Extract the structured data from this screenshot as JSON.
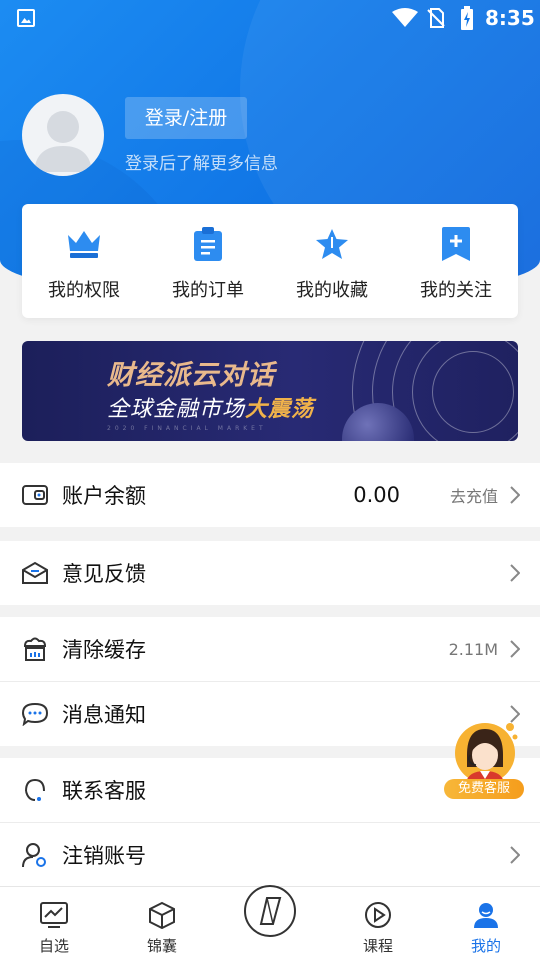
{
  "status_bar": {
    "time": "8:35"
  },
  "profile": {
    "login_button": "登录/注册",
    "hint": "登录后了解更多信息"
  },
  "quick_actions": [
    {
      "label": "我的权限",
      "icon": "crown-icon"
    },
    {
      "label": "我的订单",
      "icon": "clipboard-icon"
    },
    {
      "label": "我的收藏",
      "icon": "star-icon"
    },
    {
      "label": "我的关注",
      "icon": "bookmark-plus-icon"
    }
  ],
  "banner": {
    "title": "财经派云对话",
    "subtitle_part1": "全球金融市场",
    "subtitle_highlight": "大震荡",
    "small_text": "2020 FINANCIAL MARKET"
  },
  "menu": {
    "balance": {
      "label": "账户余额",
      "value": "0.00",
      "action": "去充值"
    },
    "feedback": {
      "label": "意见反馈"
    },
    "clear_cache": {
      "label": "清除缓存",
      "size": "2.11M"
    },
    "notifications": {
      "label": "消息通知"
    },
    "customer_service": {
      "label": "联系客服"
    },
    "delete_account": {
      "label": "注销账号"
    }
  },
  "floating_service": {
    "label": "免费客服"
  },
  "tabs": [
    {
      "label": "自选",
      "icon": "chart-line-icon"
    },
    {
      "label": "锦囊",
      "icon": "cube-icon"
    },
    {
      "label": "",
      "icon": "compass-icon"
    },
    {
      "label": "课程",
      "icon": "play-circle-icon"
    },
    {
      "label": "我的",
      "icon": "user-icon"
    }
  ],
  "colors": {
    "primary": "#1a73e8",
    "banner_gold": "#e9b98c",
    "service_orange": "#f5a623"
  }
}
